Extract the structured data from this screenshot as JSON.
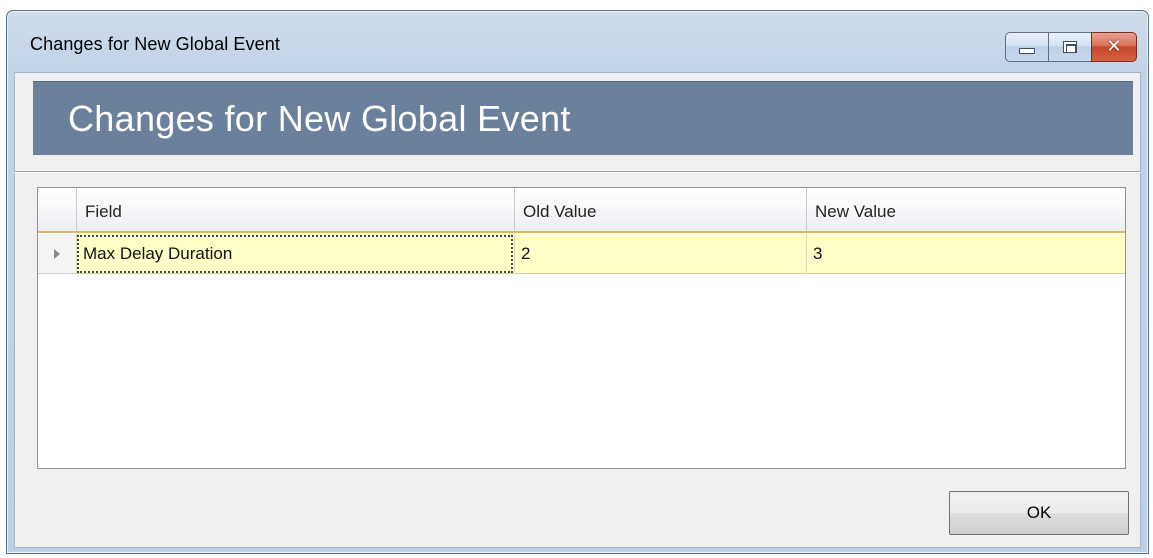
{
  "window": {
    "title": "Changes for New Global Event",
    "caption_buttons": {
      "minimize_icon": "minimize-icon",
      "maximize_icon": "maximize-icon",
      "close_icon": "close-icon",
      "close_glyph": "✕"
    }
  },
  "banner": {
    "title": "Changes for New Global Event"
  },
  "grid": {
    "columns": [
      "Field",
      "Old Value",
      "New Value"
    ],
    "rows": [
      {
        "field": "Max Delay Duration",
        "old_value": "2",
        "new_value": "3"
      }
    ],
    "row_selector_icon": "row-pointer-icon"
  },
  "buttons": {
    "ok_label": "OK"
  },
  "colors": {
    "banner_bg": "#6a809c",
    "row_highlight": "#ffffc8",
    "header_underline": "#d7ba6a"
  }
}
